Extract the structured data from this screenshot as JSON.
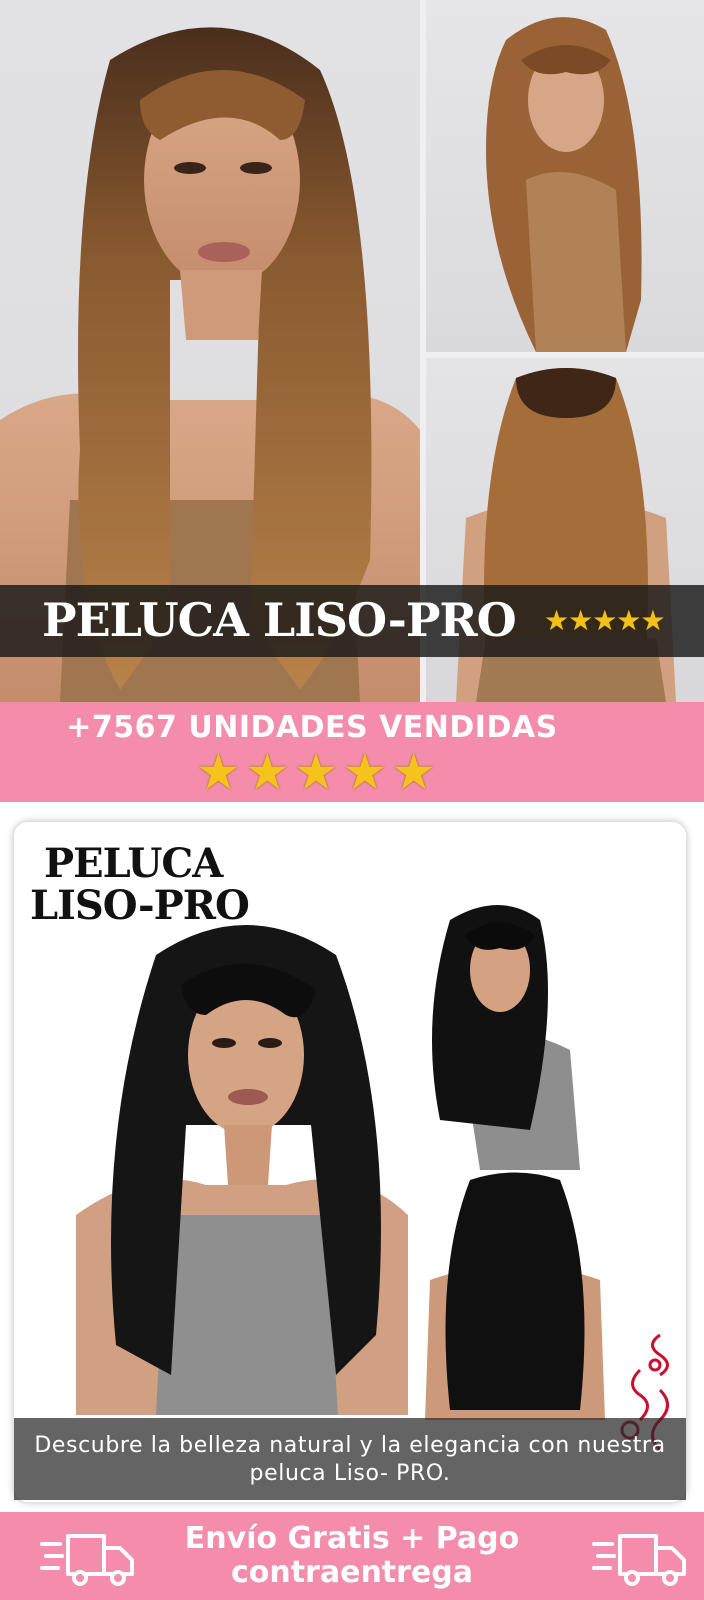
{
  "banner": {
    "title": "PELUCA LISO-PRO",
    "rating_stars": "★★★★★",
    "sold_text": "+7567 UNIDADES VENDIDAS",
    "sold_stars": "★★★★★",
    "accent_color": "#f48cab",
    "star_color": "#f2c21b"
  },
  "product_card": {
    "title_line1": "PELUCA",
    "title_line2": "LISO-PRO",
    "caption": "Descubre la belleza natural y la elegancia con nuestra peluca Liso- PRO."
  },
  "shipping": {
    "text": "Envío Gratis + Pago contraentrega",
    "icon": "delivery-truck-icon"
  }
}
